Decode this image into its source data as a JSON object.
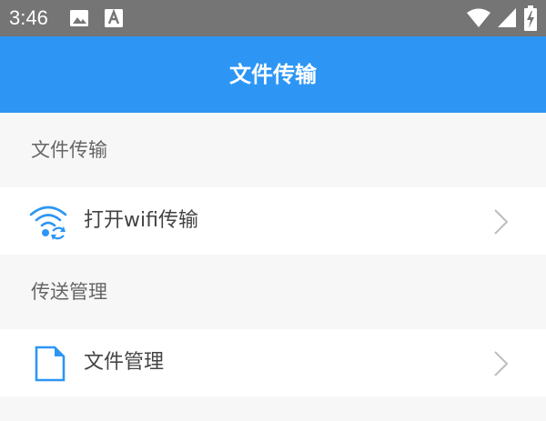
{
  "status_bar": {
    "time": "3:46",
    "icons": [
      "image-icon",
      "font-a-icon",
      "wifi-icon",
      "signal-icon",
      "battery-charging-icon"
    ]
  },
  "app_bar": {
    "title": "文件传输"
  },
  "sections": [
    {
      "header": "文件传输",
      "items": [
        {
          "label": "打开wifi传输",
          "icon": "wifi-transfer-icon"
        }
      ]
    },
    {
      "header": "传送管理",
      "items": [
        {
          "label": "文件管理",
          "icon": "document-icon"
        }
      ]
    }
  ],
  "colors": {
    "app_bar": "#2d96f5",
    "status_bar": "#757575",
    "icon_accent": "#2d96f5",
    "background": "#f7f7f7"
  }
}
